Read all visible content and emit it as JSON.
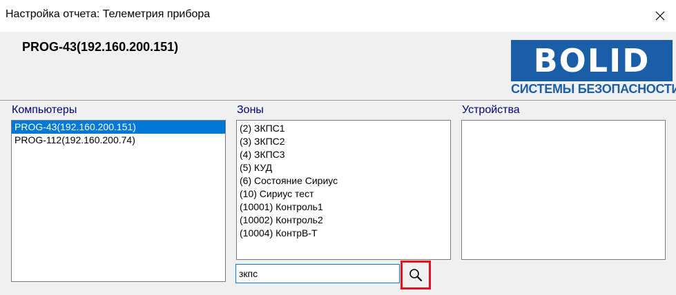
{
  "window": {
    "title": "Настройка отчета: Телеметрия прибора",
    "close_icon": "close-icon"
  },
  "header": {
    "device_name": "PROG-43(192.160.200.151)"
  },
  "logo": {
    "brand": "BOLID",
    "subtitle": "СИСТЕМЫ БЕЗОПАСНОСТИ",
    "color": "#1b5ea8"
  },
  "computers": {
    "label": "Компьютеры",
    "items": [
      "PROG-43(192.160.200.151)",
      "PROG-112(192.160.200.74)"
    ],
    "selected_index": 0
  },
  "zones": {
    "label": "Зоны",
    "items": [
      "(2) ЗКПС1",
      "(3) ЗКПС2",
      "(4) ЗКПС3",
      "(5) КУД",
      "(6) Состояние Сириус",
      "(10) Сириус тест",
      "(10001) Контроль1",
      "(10002) Контроль2",
      "(10004) КонтрВ-Т"
    ]
  },
  "devices": {
    "label": "Устройства",
    "items": []
  },
  "search": {
    "value": "зкпс",
    "button_icon": "search-icon",
    "highlight_color": "#e3141c"
  },
  "colors": {
    "selection": "#0078d7",
    "label_text": "#000080"
  }
}
